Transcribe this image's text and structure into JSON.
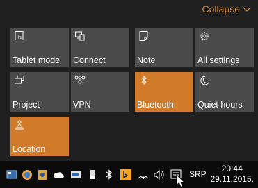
{
  "action_center": {
    "collapse_label": "Collapse",
    "accent_color": "#d07a2a",
    "tiles": [
      {
        "label": "Tablet mode",
        "icon": "tablet-mode-icon",
        "active": false
      },
      {
        "label": "Connect",
        "icon": "connect-icon",
        "active": false
      },
      {
        "label": "Note",
        "icon": "note-icon",
        "active": false
      },
      {
        "label": "All settings",
        "icon": "gear-icon",
        "active": false
      },
      {
        "label": "Project",
        "icon": "project-icon",
        "active": false
      },
      {
        "label": "VPN",
        "icon": "vpn-icon",
        "active": false
      },
      {
        "label": "Bluetooth",
        "icon": "bluetooth-icon",
        "active": true
      },
      {
        "label": "Quiet hours",
        "icon": "moon-icon",
        "active": false
      },
      {
        "label": "Location",
        "icon": "location-icon",
        "active": true
      }
    ]
  },
  "taskbar": {
    "language": "SRP",
    "time": "20:44",
    "date": "29.11.2015."
  }
}
